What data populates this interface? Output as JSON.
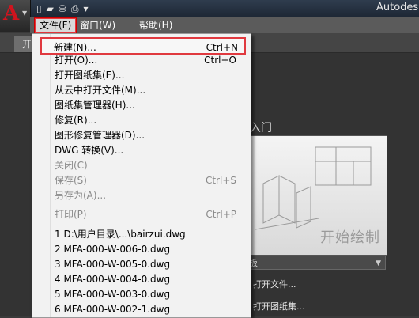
{
  "window": {
    "title": "Autodes"
  },
  "menubar": {
    "file": "文件(F)",
    "window": "窗口(W)",
    "help": "帮助(H)"
  },
  "tabs": {
    "start": "开"
  },
  "file_menu": {
    "items": [
      {
        "label": "新建(N)...",
        "shortcut": "Ctrl+N",
        "enabled": true
      },
      {
        "label": "打开(O)...",
        "shortcut": "Ctrl+O",
        "enabled": true
      },
      {
        "label": "打开图纸集(E)...",
        "shortcut": "",
        "enabled": true
      },
      {
        "label": "从云中打开文件(M)...",
        "shortcut": "",
        "enabled": true
      },
      {
        "label": "图纸集管理器(H)...",
        "shortcut": "",
        "enabled": true
      },
      {
        "label": "修复(R)...",
        "shortcut": "",
        "enabled": true
      },
      {
        "label": "图形修复管理器(D)...",
        "shortcut": "",
        "enabled": true
      },
      {
        "label": "DWG 转换(V)...",
        "shortcut": "",
        "enabled": true
      },
      {
        "label": "关闭(C)",
        "shortcut": "",
        "enabled": false
      },
      {
        "label": "保存(S)",
        "shortcut": "Ctrl+S",
        "enabled": false
      },
      {
        "label": "另存为(A)...",
        "shortcut": "",
        "enabled": false
      },
      {
        "label": "打印(P)",
        "shortcut": "Ctrl+P",
        "enabled": false
      },
      {
        "label": "1 D:\\用户目录\\...\\bairzui.dwg",
        "shortcut": "",
        "enabled": true
      },
      {
        "label": "2 MFA-000-W-006-0.dwg",
        "shortcut": "",
        "enabled": true
      },
      {
        "label": "3 MFA-000-W-005-0.dwg",
        "shortcut": "",
        "enabled": true
      },
      {
        "label": "4 MFA-000-W-004-0.dwg",
        "shortcut": "",
        "enabled": true
      },
      {
        "label": "5 MFA-000-W-003-0.dwg",
        "shortcut": "",
        "enabled": true
      },
      {
        "label": "6 MFA-000-W-002-1.dwg",
        "shortcut": "",
        "enabled": true
      }
    ]
  },
  "start_page": {
    "intro": "入门",
    "preview_caption": "开始绘制",
    "template_value": "板",
    "open_files_link": "打开文件...",
    "open_sheetset_link": "打开图纸集..."
  },
  "colors": {
    "highlight_border": "#e0393f",
    "logo_red": "#d0141e"
  }
}
